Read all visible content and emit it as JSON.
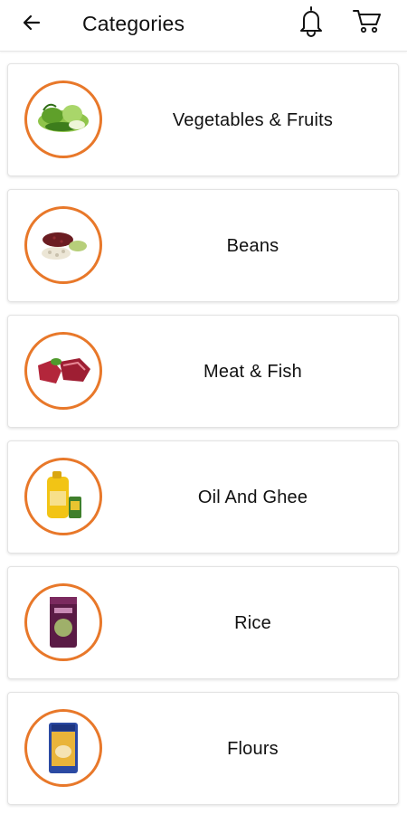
{
  "header": {
    "title": "Categories",
    "back_icon": "arrow-left-icon",
    "bell_icon": "bell-icon",
    "cart_icon": "cart-icon"
  },
  "colors": {
    "accent": "#e8782a",
    "card_border": "#e3e3e3",
    "text": "#111111"
  },
  "categories": [
    {
      "label": "Vegetables & Fruits",
      "icon": "vegetables-image"
    },
    {
      "label": "Beans",
      "icon": "beans-image"
    },
    {
      "label": "Meat & Fish",
      "icon": "meat-image"
    },
    {
      "label": "Oil And Ghee",
      "icon": "oil-image"
    },
    {
      "label": "Rice",
      "icon": "rice-image"
    },
    {
      "label": "Flours",
      "icon": "flour-image"
    }
  ]
}
